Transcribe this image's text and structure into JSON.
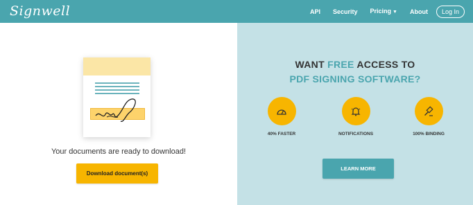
{
  "brand": {
    "logo_text": "Signwell"
  },
  "nav": {
    "links": [
      "API",
      "Security",
      "Pricing",
      "About"
    ],
    "login_label": "Log In"
  },
  "left": {
    "ready_text": "Your documents are ready to download!",
    "download_label": "Download document(s)"
  },
  "right": {
    "headline_part1": "WANT",
    "headline_free": "FREE",
    "headline_part2": "ACCESS TO",
    "headline_line2": "PDF SIGNING SOFTWARE?",
    "features": [
      {
        "label": "40% FASTER",
        "icon": "speedometer-icon"
      },
      {
        "label": "NOTIFICATIONS",
        "icon": "bell-icon"
      },
      {
        "label": "100% BINDING",
        "icon": "gavel-icon"
      }
    ],
    "learn_more_label": "LEARN MORE"
  },
  "colors": {
    "nav_bg": "#4aa5ae",
    "right_bg": "#c4e1e6",
    "accent_yellow": "#f7b500",
    "accent_teal": "#4aa5ae"
  }
}
